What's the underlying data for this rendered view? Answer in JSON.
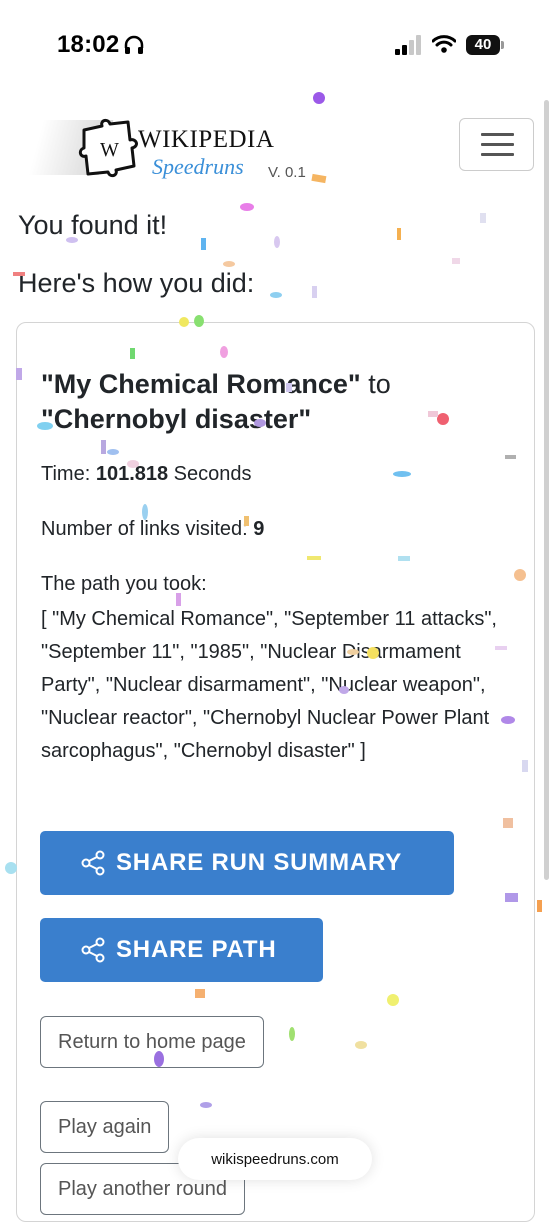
{
  "status_bar": {
    "time": "18:02",
    "battery": "40"
  },
  "navbar": {
    "logo_title": "WIKIPEDIA",
    "logo_subtitle": "Speedruns",
    "version": "V. 0.1",
    "logo_letter": "W",
    "menu_icon": "hamburger-icon"
  },
  "result": {
    "heading": "You found it!",
    "subheading": "Here's how you did:",
    "start_article": "\"My Chemical Romance\"",
    "connector": " to ",
    "end_article": "\"Chernobyl disaster\"",
    "time_label": "Time: ",
    "time_value": "101.818",
    "time_unit": " Seconds",
    "links_label": "Number of links visited: ",
    "links_value": "9",
    "path_label": "The path you took:",
    "path_text": "[ \"My Chemical Romance\", \"September 11 attacks\", \"September 11\", \"1985\", \"Nuclear Disarmament Party\", \"Nuclear disarmament\", \"Nuclear weapon\", \"Nuclear reactor\", \"Chernobyl Nuclear Power Plant sarcophagus\", \"Chernobyl disaster\" ]"
  },
  "buttons": {
    "share_summary": "SHARE RUN SUMMARY",
    "share_path": "SHARE PATH",
    "return_home": "Return to home page",
    "play_again": "Play again",
    "play_another": "Play another round"
  },
  "browser": {
    "url": "wikispeedruns.com"
  },
  "colors": {
    "primary": "#3a7fcd",
    "logo_blue": "#3a8fd8",
    "text": "#212529"
  }
}
